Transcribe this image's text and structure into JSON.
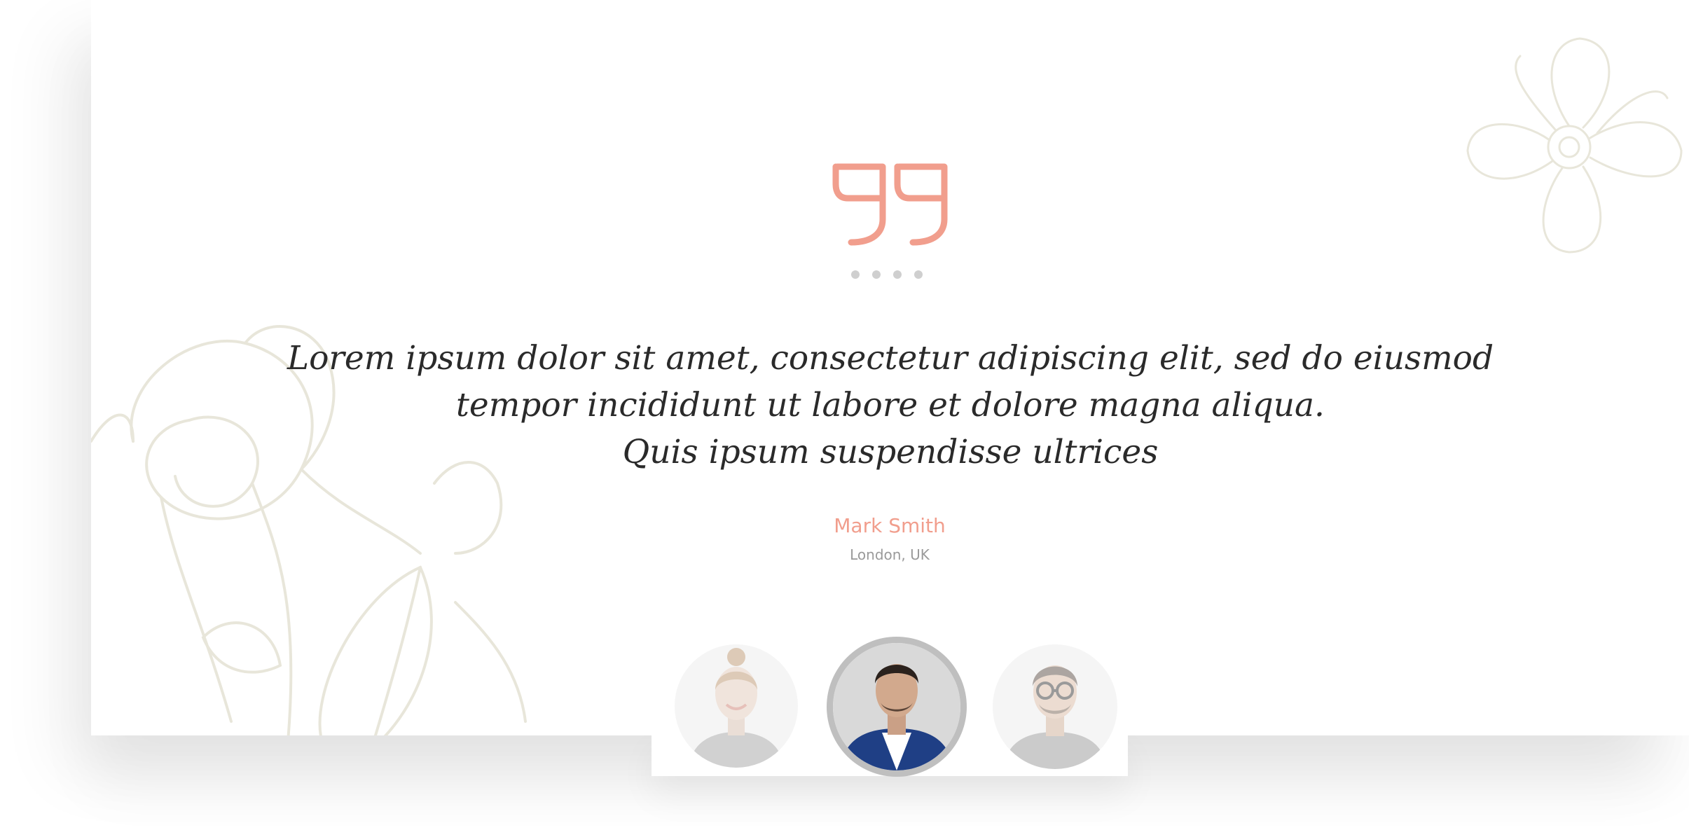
{
  "testimonial": {
    "quote_lines": [
      "Lorem ipsum dolor sit amet, consectetur adipiscing elit, sed do eiusmod",
      "tempor incididunt ut labore et dolore magna aliqua.",
      "Quis ipsum suspendisse ultrices"
    ],
    "author": "Mark Smith",
    "location": "London, UK"
  },
  "pagination": {
    "count": 4
  },
  "avatars": [
    {
      "name": "woman-avatar",
      "active": false
    },
    {
      "name": "mark-smith-avatar",
      "active": true
    },
    {
      "name": "man-glasses-avatar",
      "active": false
    }
  ],
  "colors": {
    "accent": "#f19e8d",
    "quote_text": "#2a2a2a",
    "muted": "#9a9a9a",
    "dot": "#cfcfcf",
    "floral": "#e8e6da"
  },
  "icons": {
    "quote": "quote-icon"
  }
}
